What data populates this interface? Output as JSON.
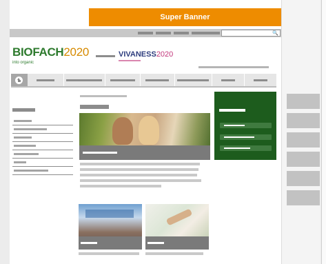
{
  "super_banner": {
    "label": "Super Banner",
    "color": "#ee8c00"
  },
  "header": {
    "biofach": {
      "name": "BIOFACH",
      "year": "2020",
      "tagline": "into organic"
    },
    "vivaness": {
      "name": "VIVANESS",
      "year": "2020"
    }
  },
  "search": {
    "value": "",
    "placeholder": "",
    "icon": "search-icon"
  },
  "nav": {
    "home_icon": "home-icon"
  },
  "colors": {
    "brand_green": "#2d7a2d",
    "brand_orange": "#d68a00",
    "vivaness_blue": "#2e3d7e",
    "vivaness_pink": "#c2357a",
    "promo_green": "#1d5c1d"
  }
}
